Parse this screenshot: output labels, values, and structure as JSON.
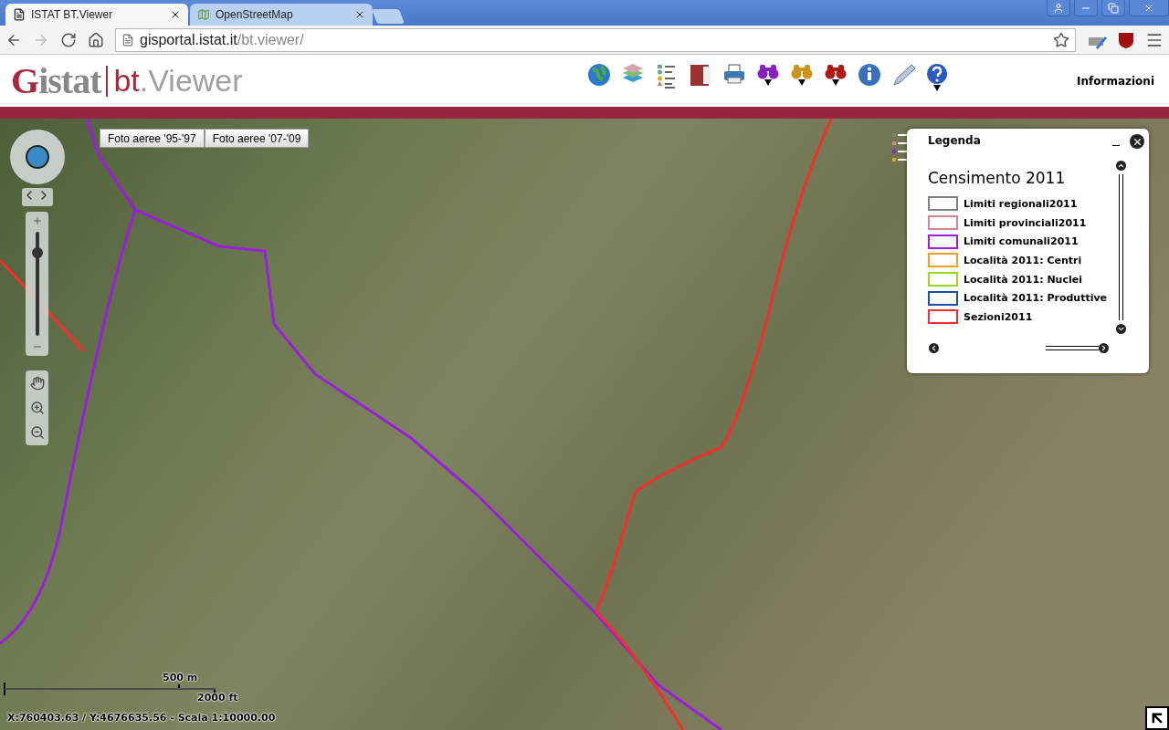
{
  "browser": {
    "tabs": [
      {
        "title": "ISTAT BT.Viewer",
        "selected": true,
        "kind": "page"
      },
      {
        "title": "OpenStreetMap",
        "selected": false,
        "kind": "map"
      }
    ],
    "address": {
      "host": "gisportal.istat.it",
      "path": "/bt.viewer/"
    }
  },
  "header": {
    "logo": {
      "brand": "Gistat",
      "product_prefix": "bt",
      "product_separator": ".",
      "product_name": "Viewer"
    },
    "tools": [
      {
        "kind": "globe",
        "dropdown": false
      },
      {
        "kind": "layers",
        "dropdown": false
      },
      {
        "kind": "list",
        "dropdown": false
      },
      {
        "kind": "book",
        "dropdown": false
      },
      {
        "kind": "printer",
        "dropdown": false
      },
      {
        "kind": "binoculars",
        "color": "#8a1fc0",
        "dropdown": true
      },
      {
        "kind": "binoculars",
        "color": "#c8961c",
        "dropdown": true
      },
      {
        "kind": "binoculars",
        "color": "#b01818",
        "dropdown": true
      },
      {
        "kind": "info",
        "dropdown": false
      },
      {
        "kind": "pencil",
        "dropdown": false
      },
      {
        "kind": "help",
        "dropdown": true
      }
    ],
    "info_link": "Informazioni"
  },
  "map": {
    "photo_buttons": [
      {
        "label": "Foto aeree '95-'97",
        "selected": false
      },
      {
        "label": "Foto aeree '07-'09",
        "selected": false
      }
    ],
    "legend": {
      "title": "Legenda",
      "heading": "Censimento 2011",
      "items": [
        {
          "label": "Limiti regionali2011",
          "color": "#808080"
        },
        {
          "label": "Limiti provinciali2011",
          "color": "#d08890"
        },
        {
          "label": "Limiti comunali2011",
          "color": "#9a1fd8"
        },
        {
          "label": "Località 2011: Centri",
          "color": "#f0a020"
        },
        {
          "label": "Località 2011: Nuclei",
          "color": "#9ad820"
        },
        {
          "label": "Località 2011: Produttive",
          "color": "#1a50a8"
        },
        {
          "label": "Sezioni2011",
          "color": "#f03030"
        }
      ]
    },
    "zoom": {
      "level": 0.8
    },
    "scale": {
      "metric": "500 m",
      "imperial": "2000 ft"
    },
    "coordinates": "X:760403.63 / Y:4676635.56 - Scala 1:10000.00"
  }
}
